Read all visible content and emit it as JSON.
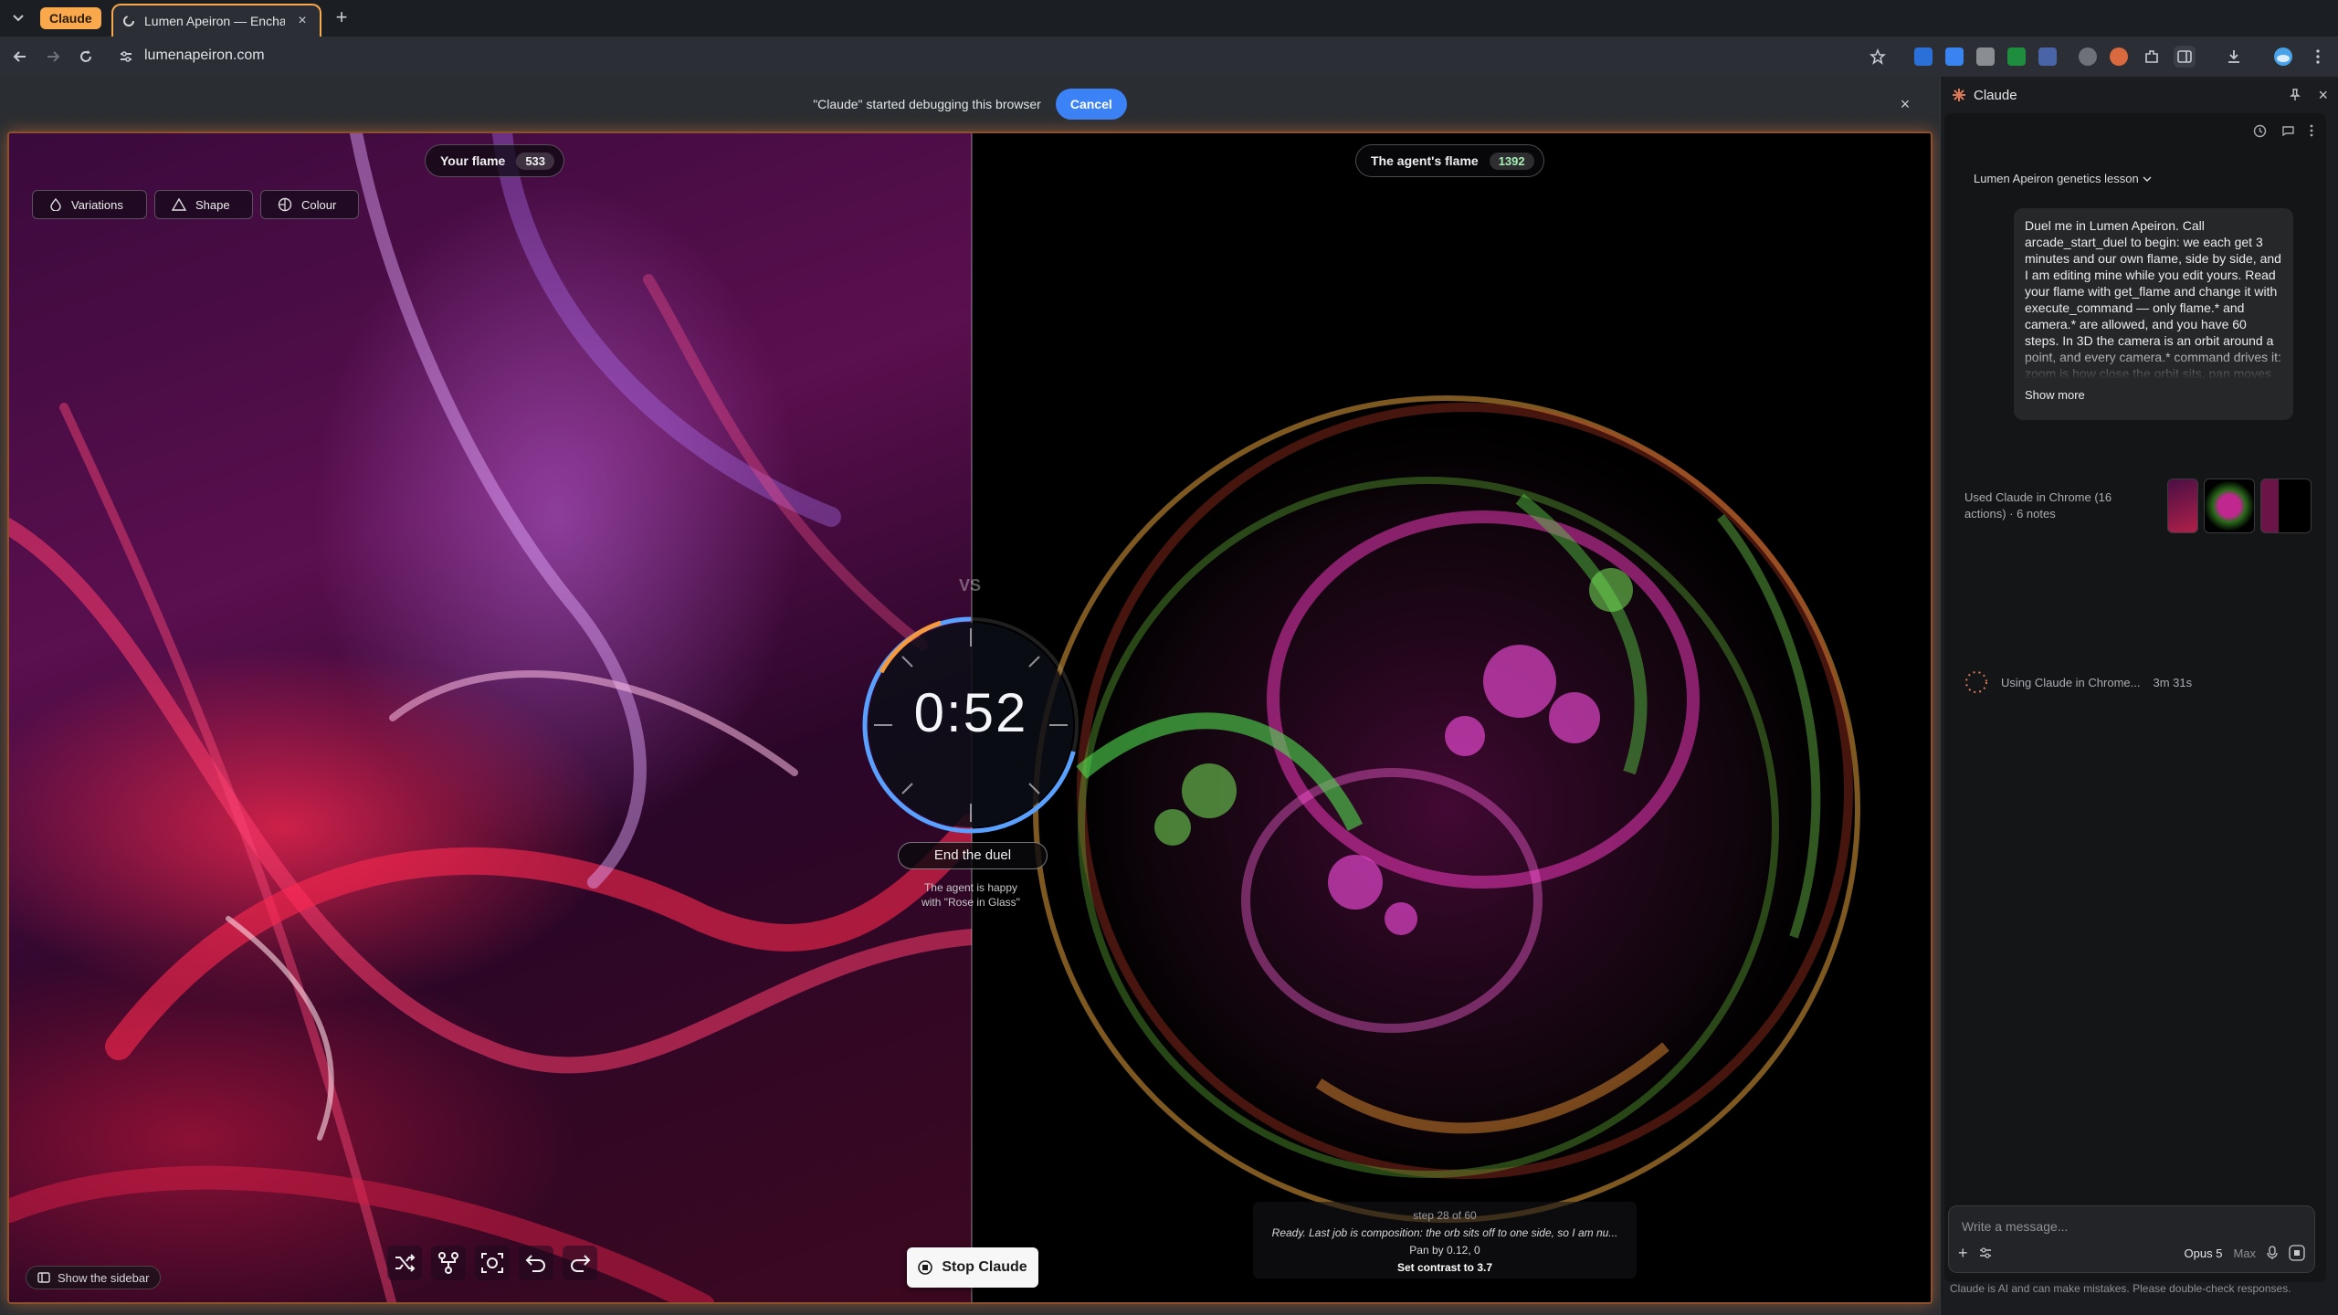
{
  "browser": {
    "tab_group_label": "Claude",
    "active_tab_title": "Lumen Apeiron — Enchanted",
    "url": "lumenapeiron.com"
  },
  "debug_banner": {
    "message": "\"Claude\" started debugging this browser",
    "cancel_label": "Cancel"
  },
  "game": {
    "your_flame_label": "Your flame",
    "your_flame_score": "533",
    "agent_flame_label": "The agent's flame",
    "agent_flame_score": "1392",
    "controls": [
      {
        "label": "Variations",
        "icon": "drop-icon"
      },
      {
        "label": "Shape",
        "icon": "triangle-icon"
      },
      {
        "label": "Colour",
        "icon": "palette-icon"
      }
    ],
    "vs_label": "VS",
    "timer": "0:52",
    "timer_fraction_remaining": 0.29,
    "end_duel_label": "End the duel",
    "agent_status_line1": "The agent is happy",
    "agent_status_line2": "with \"Rose in Glass\"",
    "log": {
      "step": "step 28 of 60",
      "thought": "Ready. Last job is composition: the orb sits off to one side, so I am nu...",
      "action1": "Pan by 0.12, 0",
      "action2": "Set contrast to 3.7"
    },
    "stop_label": "Stop Claude",
    "show_sidebar_label": "Show the sidebar",
    "tool_icons": [
      "shuffle-icon",
      "mutate-icon",
      "screenshot-icon",
      "undo-icon",
      "redo-icon"
    ]
  },
  "claude_panel": {
    "title": "Claude",
    "conversation_title": "Lumen Apeiron genetics lesson",
    "user_message": "Duel me in Lumen Apeiron. Call arcade_start_duel to begin: we each get 3 minutes and our own flame, side by side, and I am editing mine while you edit yours. Read your flame with get_flame and change it with execute_command — only flame.* and camera.* are allowed, and you have 60 steps. In 3D the camera is an orbit around a point, and every camera.* command drives it: zoom is how close the orbit sits, pan moves the point it looks at in",
    "show_more": "Show more",
    "used_line1": "Used Claude in Chrome (16",
    "used_line2": "actions) · 6 notes",
    "using_status": "Using Claude in Chrome...",
    "using_time": "3m 31s",
    "composer_placeholder": "Write a message...",
    "model": "Opus 5",
    "effort": "Max",
    "disclaimer": "Claude is AI and can make mistakes. Please double-check responses."
  },
  "colors": {
    "accent_orange": "#f9a94b",
    "cancel_blue": "#3b82f6",
    "timer_blue": "#5aa0ff",
    "timer_orange": "#f59a3c"
  }
}
